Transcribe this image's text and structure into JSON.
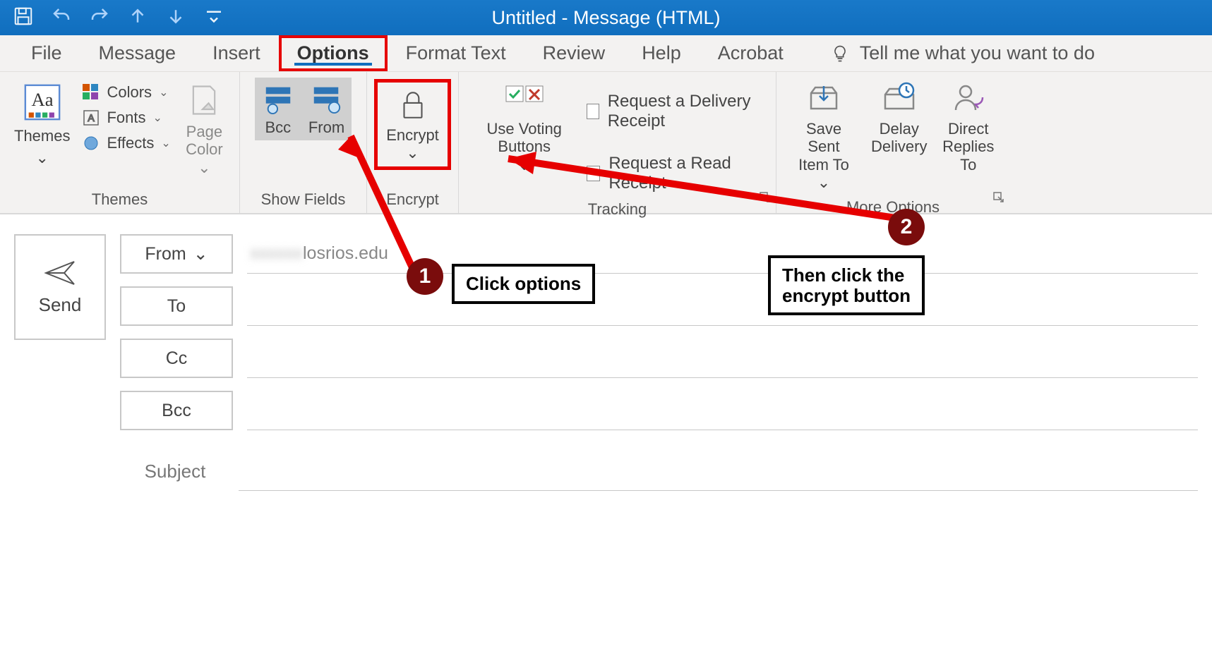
{
  "titlebar": {
    "title": "Untitled  -  Message (HTML)"
  },
  "tabs": {
    "file": "File",
    "message": "Message",
    "insert": "Insert",
    "options": "Options",
    "format_text": "Format Text",
    "review": "Review",
    "help": "Help",
    "acrobat": "Acrobat",
    "tell_me": "Tell me what you want to do"
  },
  "ribbon": {
    "themes_group": {
      "themes": "Themes",
      "colors": "Colors",
      "fonts": "Fonts",
      "effects": "Effects",
      "page_color": "Page Color",
      "label": "Themes"
    },
    "show_fields": {
      "bcc": "Bcc",
      "from": "From",
      "label": "Show Fields"
    },
    "encrypt_group": {
      "encrypt": "Encrypt",
      "label": "Encrypt"
    },
    "tracking": {
      "use_voting": "Use Voting Buttons",
      "delivery": "Request a Delivery Receipt",
      "read": "Request a Read Receipt",
      "label": "Tracking"
    },
    "more_options": {
      "save_sent": "Save Sent Item To",
      "delay": "Delay Delivery",
      "direct": "Direct Replies To",
      "label": "More Options"
    }
  },
  "compose": {
    "send": "Send",
    "from_btn": "From",
    "to_btn": "To",
    "cc_btn": "Cc",
    "bcc_btn": "Bcc",
    "subject_label": "Subject",
    "from_value_visible": "losrios.edu"
  },
  "annotations": {
    "step1_num": "1",
    "step1_text": "Click options",
    "step2_num": "2",
    "step2_text": "Then click the encrypt button"
  }
}
